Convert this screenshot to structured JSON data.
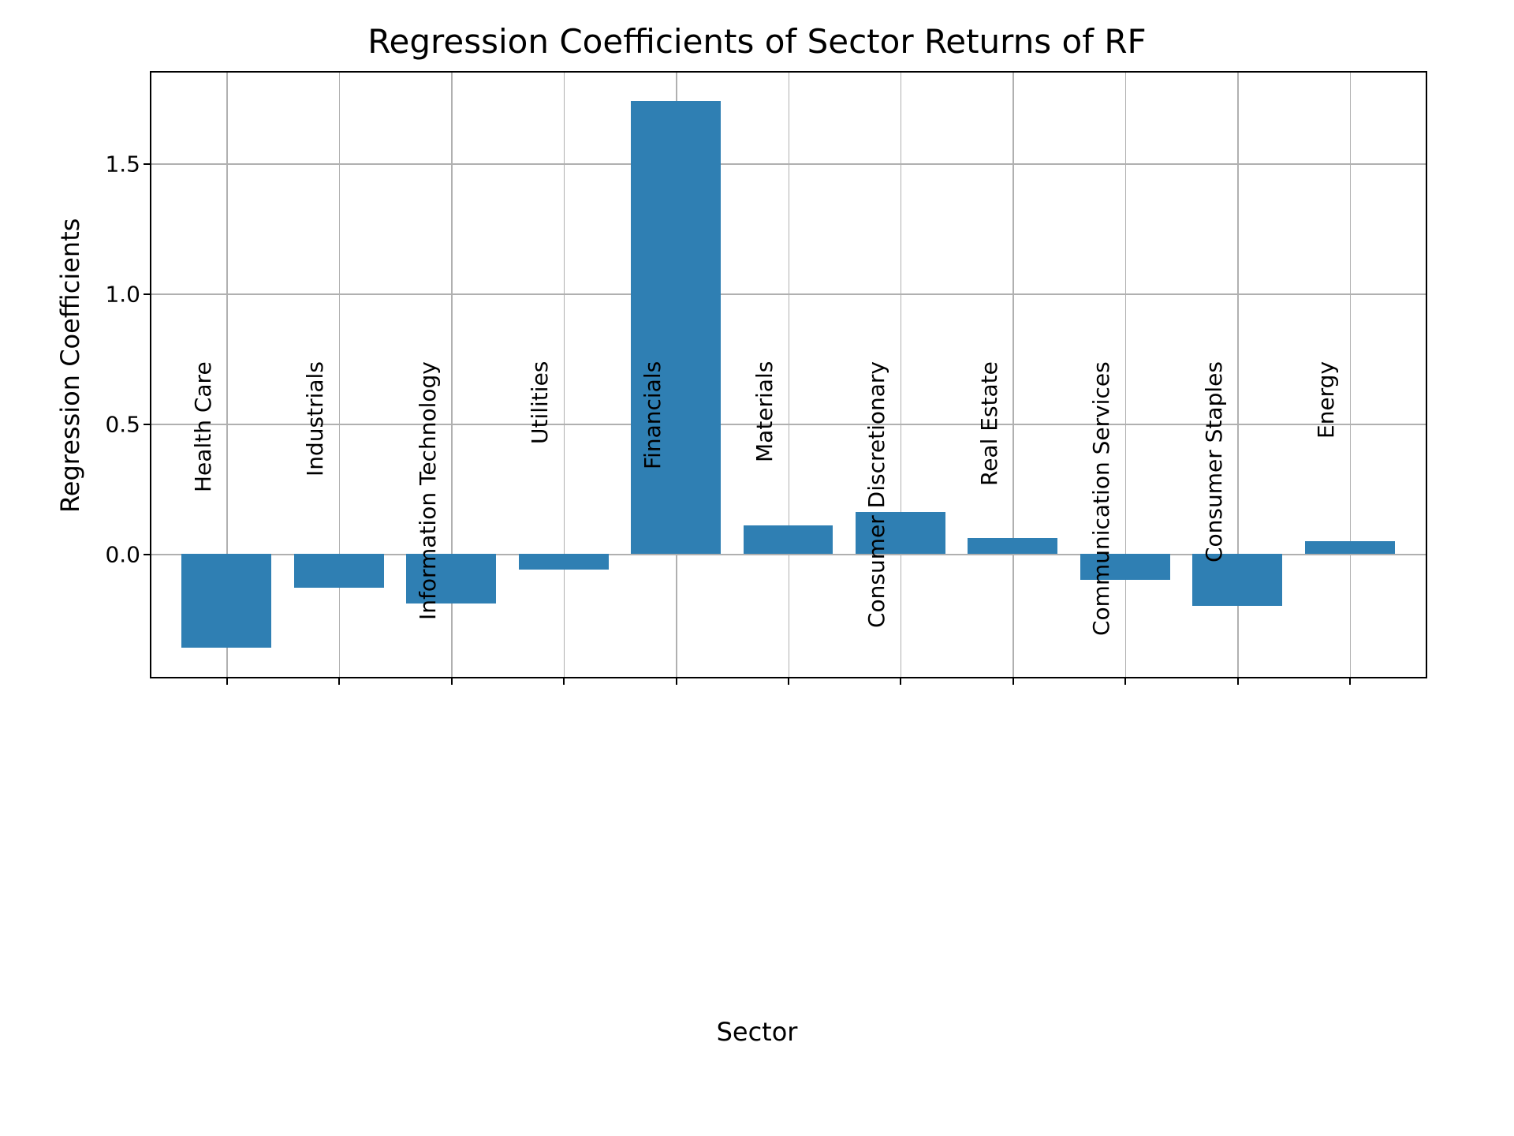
{
  "chart_data": {
    "type": "bar",
    "title": "Regression Coefficients of Sector Returns of RF",
    "xlabel": "Sector",
    "ylabel": "Regression Coefficients",
    "categories": [
      "Health Care",
      "Industrials",
      "Information Technology",
      "Utilities",
      "Financials",
      "Materials",
      "Consumer Discretionary",
      "Real Estate",
      "Communication Services",
      "Consumer Staples",
      "Energy"
    ],
    "values": [
      -0.36,
      -0.13,
      -0.19,
      -0.06,
      1.74,
      0.11,
      0.16,
      0.06,
      -0.1,
      -0.2,
      0.05
    ],
    "ylim": [
      -0.47,
      1.85
    ],
    "yticks": [
      0.0,
      0.5,
      1.0,
      1.5
    ],
    "ytick_labels": [
      "0.0",
      "0.5",
      "1.0",
      "1.5"
    ],
    "bar_color": "#2f7fb3",
    "grid": true
  }
}
